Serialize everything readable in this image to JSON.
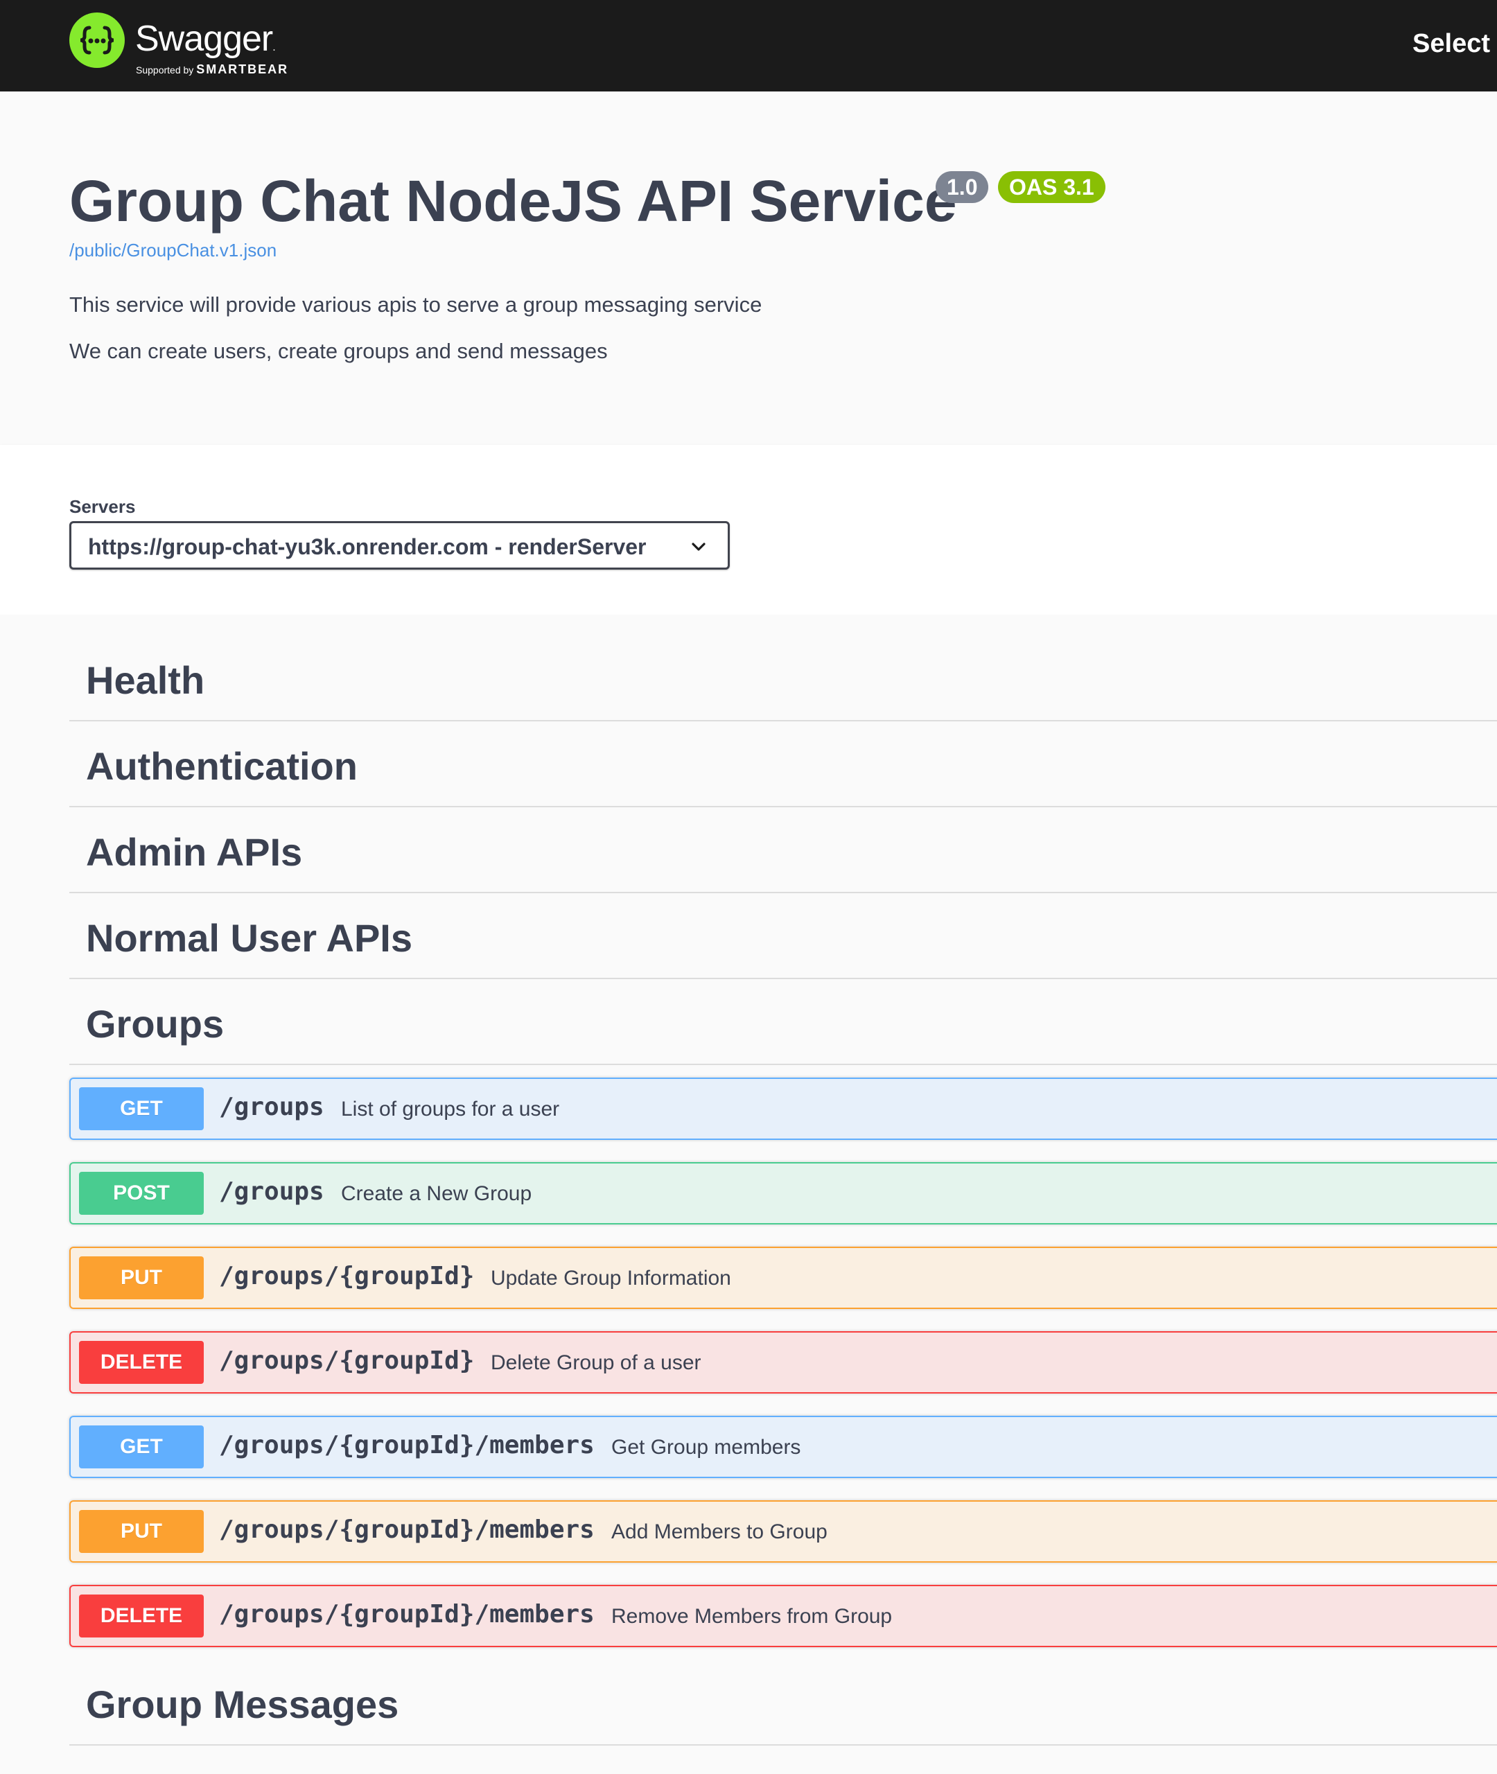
{
  "topbar": {
    "brand": "Swagger",
    "trademark": ".",
    "supported_by": "Supported by",
    "smartbear": "SMARTBEAR",
    "select_label": "Select",
    "logo_icon": "swagger-braces-icon",
    "brand_color": "#85ea2d"
  },
  "info": {
    "title": "Group Chat NodeJS API Service",
    "version": "1.0",
    "oas": "OAS 3.1",
    "spec_link": "/public/GroupChat.v1.json",
    "description_lines": [
      "This service will provide various apis to serve a group messaging service",
      "We can create users, create groups and send messages"
    ]
  },
  "servers": {
    "label": "Servers",
    "selected": "https://group-chat-yu3k.onrender.com - renderServer",
    "icon": "chevron-down-icon"
  },
  "tags": [
    {
      "name": "Health"
    },
    {
      "name": "Authentication"
    },
    {
      "name": "Admin APIs"
    },
    {
      "name": "Normal User APIs"
    },
    {
      "name": "Groups"
    },
    {
      "name": "Group Messages"
    }
  ],
  "operations": [
    {
      "method": "GET",
      "path": "/groups",
      "summary": "List of groups for a user"
    },
    {
      "method": "POST",
      "path": "/groups",
      "summary": "Create a New Group"
    },
    {
      "method": "PUT",
      "path": "/groups/{groupId}",
      "summary": "Update Group Information"
    },
    {
      "method": "DELETE",
      "path": "/groups/{groupId}",
      "summary": "Delete Group of a user"
    },
    {
      "method": "GET",
      "path": "/groups/{groupId}/members",
      "summary": "Get Group members"
    },
    {
      "method": "PUT",
      "path": "/groups/{groupId}/members",
      "summary": "Add Members to Group"
    },
    {
      "method": "DELETE",
      "path": "/groups/{groupId}/members",
      "summary": "Remove Members from Group"
    }
  ],
  "colors": {
    "get": "#61affe",
    "post": "#49cc90",
    "put": "#fca130",
    "delete": "#f93e3e",
    "version_badge": "#7d8492",
    "oas_badge": "#89bf04",
    "link": "#4990e2"
  }
}
